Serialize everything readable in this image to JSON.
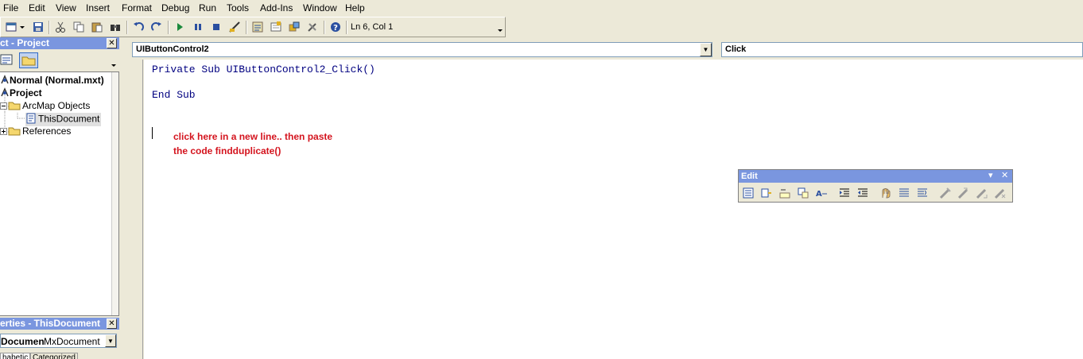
{
  "menu": [
    "File",
    "Edit",
    "View",
    "Insert",
    "Format",
    "Debug",
    "Run",
    "Tools",
    "Add-Ins",
    "Window",
    "Help"
  ],
  "toolbar": {
    "status": "Ln 6, Col 1"
  },
  "project": {
    "title": "ct - Project",
    "close": "✕",
    "tree": [
      {
        "label": "Normal (Normal.mxt)",
        "bold": true
      },
      {
        "label": "Project",
        "bold": true
      },
      {
        "label": "ArcMap Objects",
        "bold": false
      },
      {
        "label": "ThisDocument",
        "bold": false
      },
      {
        "label": "References",
        "bold": false
      }
    ]
  },
  "properties": {
    "title": "erties - ThisDocument",
    "close": "✕",
    "combo_name": "Documen",
    "combo_value": "MxDocument",
    "tabs": [
      "habetic",
      "Categorized"
    ]
  },
  "code": {
    "object_combo": "UIButtonControl2",
    "proc_combo": "Click",
    "lines": [
      "Private Sub UIButtonControl2_Click()",
      "End Sub"
    ],
    "annotation_line1": "click here in a new line.. then paste",
    "annotation_line2": "the code findduplicate()"
  },
  "edit_toolbar": {
    "title": "Edit",
    "dropdown": "▾",
    "close": "✕"
  },
  "colors": {
    "titlebar": "#7a96df",
    "annotation": "#d4141e",
    "chrome": "#ece9d8"
  }
}
